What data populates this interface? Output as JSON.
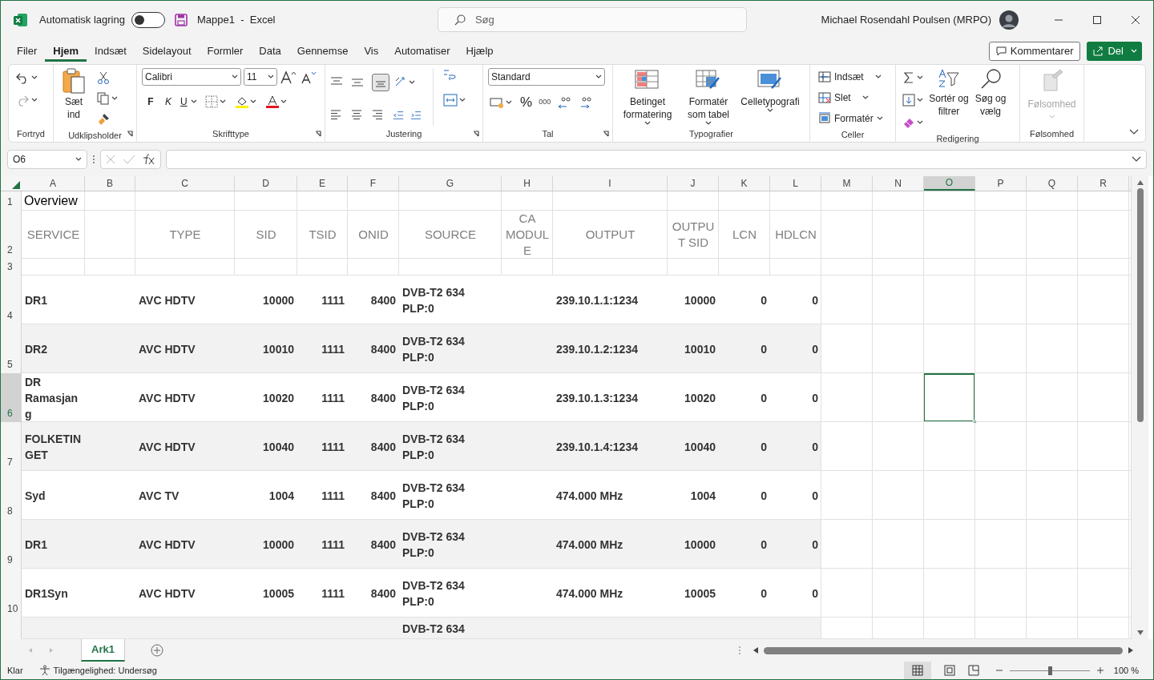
{
  "title_bar": {
    "autosave_label": "Automatisk lagring",
    "autosave_on": false,
    "document": "Mappe1  -  Excel",
    "search_placeholder": "Søg",
    "user": "Michael Rosendahl Poulsen (MRPO)"
  },
  "menu_tabs": [
    {
      "label": "Filer",
      "selected": false
    },
    {
      "label": "Hjem",
      "selected": true
    },
    {
      "label": "Indsæt",
      "selected": false
    },
    {
      "label": "Sidelayout",
      "selected": false
    },
    {
      "label": "Formler",
      "selected": false
    },
    {
      "label": "Data",
      "selected": false
    },
    {
      "label": "Gennemse",
      "selected": false
    },
    {
      "label": "Vis",
      "selected": false
    },
    {
      "label": "Automatiser",
      "selected": false
    },
    {
      "label": "Hjælp",
      "selected": false
    }
  ],
  "share_buttons": {
    "comments": "Kommentarer",
    "share": "Del"
  },
  "ribbon": [
    {
      "kind": "undo",
      "label": "Fortryd"
    },
    {
      "kind": "clipboard",
      "label": "Udklipsholder",
      "paste": "Sæt ind"
    },
    {
      "kind": "font",
      "label": "Skrifttype",
      "font": "Calibri",
      "size": "11",
      "bold": "F",
      "italic": "K",
      "underline": "U"
    },
    {
      "kind": "align",
      "label": "Justering"
    },
    {
      "kind": "number",
      "label": "Tal",
      "format": "Standard",
      "percent": "%",
      "thousands": "000"
    },
    {
      "kind": "styles",
      "label": "Typografier",
      "buttons": [
        "Betinget formatering",
        "Formatér som tabel",
        "Celletypografi"
      ]
    },
    {
      "kind": "cells",
      "label": "Celler",
      "buttons": [
        "Indsæt",
        "Slet",
        "Formatér"
      ]
    },
    {
      "kind": "editing",
      "label": "Redigering",
      "buttons": [
        "Sortér og filtrer",
        "Søg og vælg"
      ]
    },
    {
      "kind": "sensitivity",
      "label": "Følsomhed",
      "buttons": [
        "Følsomhed"
      ],
      "disabled": true
    }
  ],
  "formula_bar": {
    "name_box": "O6"
  },
  "sheet": {
    "columns": [
      {
        "letter": "A",
        "selected": false
      },
      {
        "letter": "B",
        "selected": false
      },
      {
        "letter": "C",
        "selected": false
      },
      {
        "letter": "D",
        "selected": false
      },
      {
        "letter": "E",
        "selected": false
      },
      {
        "letter": "F",
        "selected": false
      },
      {
        "letter": "G",
        "selected": false
      },
      {
        "letter": "H",
        "selected": false
      },
      {
        "letter": "I",
        "selected": false
      },
      {
        "letter": "J",
        "selected": false
      },
      {
        "letter": "K",
        "selected": false
      },
      {
        "letter": "L",
        "selected": false
      },
      {
        "letter": "M",
        "selected": false
      },
      {
        "letter": "N",
        "selected": false
      },
      {
        "letter": "O",
        "selected": true
      },
      {
        "letter": "P",
        "selected": false
      },
      {
        "letter": "Q",
        "selected": false
      },
      {
        "letter": "R",
        "selected": false
      }
    ],
    "rows": [
      {
        "number": "1",
        "kind": "title",
        "selected": false,
        "cells": [
          "Overview"
        ]
      },
      {
        "number": "2",
        "kind": "header",
        "selected": false,
        "cells": [
          "SERVICE",
          null,
          "TYPE",
          "SID",
          "TSID",
          "ONID",
          "SOURCE",
          "CA MODULE",
          "OUTPUT",
          "OUTPUT SID",
          "LCN",
          "HDLCN"
        ]
      },
      {
        "number": "3",
        "kind": "blank",
        "selected": false,
        "cells": []
      },
      {
        "number": "4",
        "kind": "data",
        "selected": false,
        "cells": [
          "DR1",
          null,
          "AVC HDTV",
          "10000",
          "1111",
          "8400",
          "DVB-T2 634 PLP:0",
          null,
          "239.10.1.1:1234",
          "10000",
          "0",
          "0"
        ]
      },
      {
        "number": "5",
        "kind": "data",
        "selected": false,
        "cells": [
          "DR2",
          null,
          "AVC HDTV",
          "10010",
          "1111",
          "8400",
          "DVB-T2 634 PLP:0",
          null,
          "239.10.1.2:1234",
          "10010",
          "0",
          "0"
        ]
      },
      {
        "number": "6",
        "kind": "data",
        "selected": true,
        "cells": [
          "DR Ramasjang",
          null,
          "AVC HDTV",
          "10020",
          "1111",
          "8400",
          "DVB-T2 634 PLP:0",
          null,
          "239.10.1.3:1234",
          "10020",
          "0",
          "0"
        ]
      },
      {
        "number": "7",
        "kind": "data",
        "selected": false,
        "cells": [
          "FOLKETINGET",
          null,
          "AVC HDTV",
          "10040",
          "1111",
          "8400",
          "DVB-T2 634 PLP:0",
          null,
          "239.10.1.4:1234",
          "10040",
          "0",
          "0"
        ]
      },
      {
        "number": "8",
        "kind": "data",
        "selected": false,
        "cells": [
          "Syd",
          null,
          "AVC TV",
          "1004",
          "1111",
          "8400",
          "DVB-T2 634 PLP:0",
          null,
          "474.000 MHz",
          "1004",
          "0",
          "0"
        ]
      },
      {
        "number": "9",
        "kind": "data",
        "selected": false,
        "cells": [
          "DR1",
          null,
          "AVC HDTV",
          "10000",
          "1111",
          "8400",
          "DVB-T2 634 PLP:0",
          null,
          "474.000 MHz",
          "10000",
          "0",
          "0"
        ]
      },
      {
        "number": "10",
        "kind": "data",
        "selected": false,
        "cells": [
          "DR1Syn",
          null,
          "AVC HDTV",
          "10005",
          "1111",
          "8400",
          "DVB-T2 634 PLP:0",
          null,
          "474.000 MHz",
          "10005",
          "0",
          "0"
        ]
      },
      {
        "kind": "cut",
        "cells": [
          null,
          null,
          null,
          null,
          null,
          null,
          "DVB-T2 634"
        ]
      }
    ]
  },
  "sheet_tabs": [
    {
      "label": "Ark1",
      "selected": true
    }
  ],
  "status_bar": {
    "ready": "Klar",
    "accessibility": "Tilgængelighed: Undersøg",
    "zoom": "100 %",
    "zoom_slider": {
      "level": 0.5
    }
  }
}
